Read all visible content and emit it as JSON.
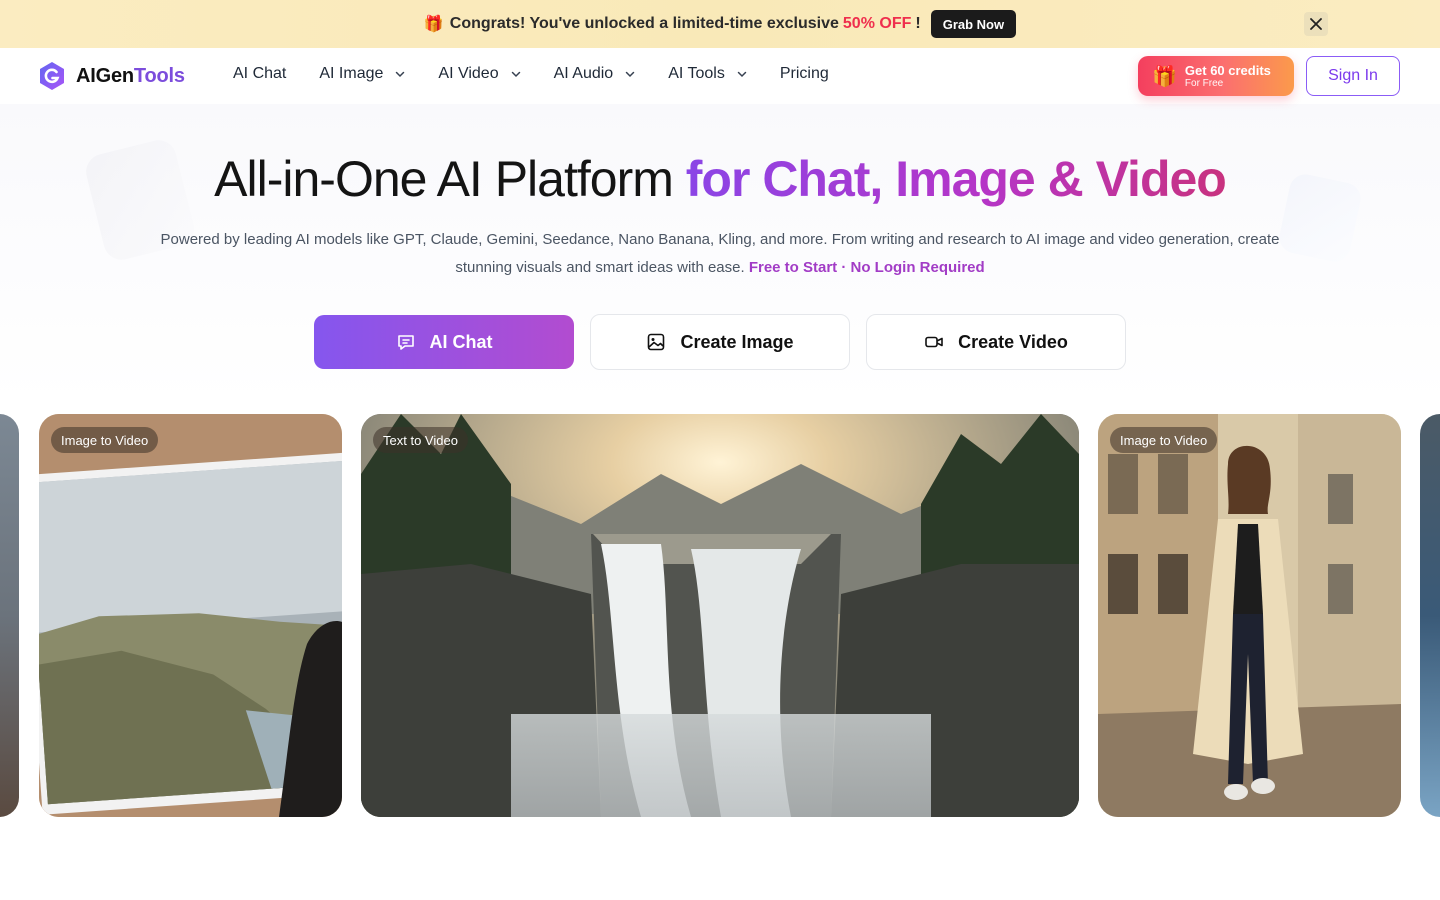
{
  "promo": {
    "gift_icon": "gift-icon",
    "text_prefix": "Congrats! You've unlocked a limited-time exclusive",
    "discount": "50% OFF",
    "suffix": "!",
    "button_label": "Grab Now",
    "close_icon": "close-icon"
  },
  "nav": {
    "logo_part1": "AIGen",
    "logo_part2": "Tools",
    "items": [
      {
        "label": "AI Chat",
        "has_dropdown": false
      },
      {
        "label": "AI Image",
        "has_dropdown": true
      },
      {
        "label": "AI Video",
        "has_dropdown": true
      },
      {
        "label": "AI Audio",
        "has_dropdown": true
      },
      {
        "label": "AI Tools",
        "has_dropdown": true
      },
      {
        "label": "Pricing",
        "has_dropdown": false
      }
    ],
    "credits_main": "Get 60 credits",
    "credits_sub": "For Free",
    "signin_label": "Sign In"
  },
  "hero": {
    "title_plain": "All-in-One AI Platform",
    "title_gradient": "for Chat, Image & Video",
    "subtitle": "Powered by leading AI models like GPT, Claude, Gemini, Seedance, Nano Banana, Kling, and more. From writing and research to AI image and video generation, create stunning visuals and smart ideas with ease.",
    "subtitle_highlight": "Free to Start · No Login Required"
  },
  "cta": {
    "chat_label": "AI Chat",
    "image_label": "Create Image",
    "video_label": "Create Video"
  },
  "gallery": {
    "cards": [
      {
        "badge": "Image to Video"
      },
      {
        "badge": "Text to Video"
      },
      {
        "badge": "Image to Video"
      }
    ]
  },
  "colors": {
    "brand_purple": "#7c4ddc",
    "promo_red": "#ef2f4d",
    "credits_gradient_start": "#f43f5e",
    "credits_gradient_end": "#fb9a4b"
  }
}
